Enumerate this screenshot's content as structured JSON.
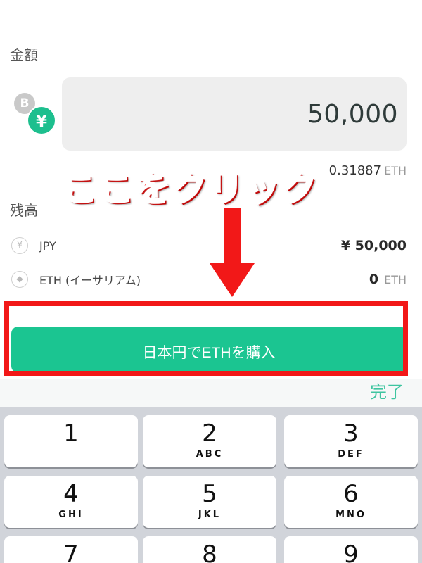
{
  "amount_section": {
    "label": "金額",
    "value": "50,000"
  },
  "coins": {
    "btc_symbol": "B",
    "yen_symbol": "¥"
  },
  "conversion": {
    "value": "0.31887",
    "unit": "ETH"
  },
  "annotation": {
    "text": "ここをクリック",
    "color": "#ff1a1a"
  },
  "balance_section": {
    "label": "残高",
    "rows": [
      {
        "icon": "yen-icon",
        "icon_glyph": "¥",
        "name": "JPY",
        "amount": "¥ 50,000",
        "unit": ""
      },
      {
        "icon": "eth-icon",
        "icon_glyph": "◆",
        "name": "ETH (イーサリアム)",
        "amount": "0",
        "unit": "ETH"
      }
    ]
  },
  "buy_button": {
    "label": "日本円でETHを購入",
    "color": "#1bc591"
  },
  "keyboard": {
    "done_label": "完了",
    "keys": [
      {
        "num": "1",
        "letters": ""
      },
      {
        "num": "2",
        "letters": "ABC"
      },
      {
        "num": "3",
        "letters": "DEF"
      },
      {
        "num": "4",
        "letters": "GHI"
      },
      {
        "num": "5",
        "letters": "JKL"
      },
      {
        "num": "6",
        "letters": "MNO"
      },
      {
        "num": "7",
        "letters": ""
      },
      {
        "num": "8",
        "letters": ""
      },
      {
        "num": "9",
        "letters": ""
      }
    ]
  }
}
